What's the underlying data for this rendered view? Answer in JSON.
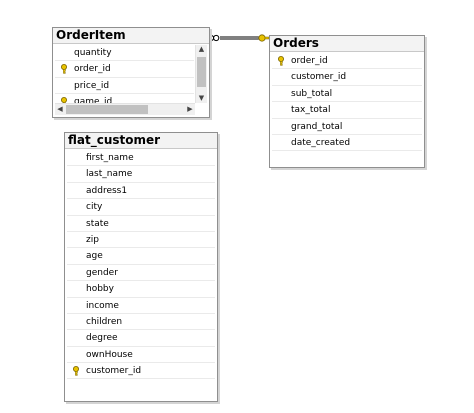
{
  "tables": {
    "orderitem": {
      "title": "OrderItem",
      "columns": [
        {
          "name": "quantity",
          "key": false
        },
        {
          "name": "order_id",
          "key": true
        },
        {
          "name": "price_id",
          "key": false
        },
        {
          "name": "game_id",
          "key": true
        }
      ]
    },
    "orders": {
      "title": "Orders",
      "columns": [
        {
          "name": "order_id",
          "key": true
        },
        {
          "name": "customer_id",
          "key": false
        },
        {
          "name": "sub_total",
          "key": false
        },
        {
          "name": "tax_total",
          "key": false
        },
        {
          "name": "grand_total",
          "key": false
        },
        {
          "name": "date_created",
          "key": false
        }
      ]
    },
    "flat_customer": {
      "title": "flat_customer",
      "columns": [
        {
          "name": "first_name",
          "key": false
        },
        {
          "name": "last_name",
          "key": false
        },
        {
          "name": "address1",
          "key": false
        },
        {
          "name": "city",
          "key": false
        },
        {
          "name": "state",
          "key": false
        },
        {
          "name": "zip",
          "key": false
        },
        {
          "name": "age",
          "key": false
        },
        {
          "name": "gender",
          "key": false
        },
        {
          "name": "hobby",
          "key": false
        },
        {
          "name": "income",
          "key": false
        },
        {
          "name": "children",
          "key": false
        },
        {
          "name": "degree",
          "key": false
        },
        {
          "name": "ownHouse",
          "key": false
        },
        {
          "name": "customer_id",
          "key": true
        }
      ]
    }
  },
  "relationships": [
    {
      "from": "OrderItem",
      "to": "Orders",
      "from_end": "many",
      "to_end": "one"
    }
  ],
  "icons": {
    "primary_key": "key-icon",
    "many_end": "infinity-icon",
    "one_end": "key-icon"
  },
  "colors": {
    "key": "#e8c200",
    "border": "#8f8f8f",
    "header": "#f3f3f3"
  }
}
